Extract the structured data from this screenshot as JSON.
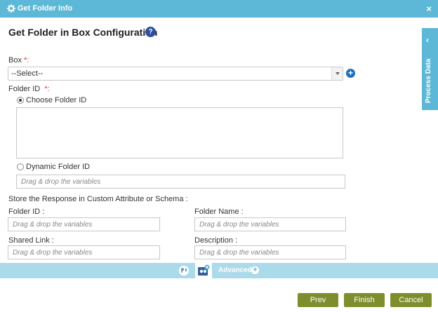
{
  "window": {
    "title": "Get Folder Info",
    "close_icon": "×"
  },
  "page": {
    "heading": "Get Folder in Box Configuration",
    "help_icon": "?"
  },
  "box": {
    "label": "Box",
    "required_mark": "*:",
    "selected": "--Select--"
  },
  "folder_id": {
    "label": "Folder ID",
    "required_mark": "*:",
    "choose_label": "Choose Folder ID",
    "dynamic_label": "Dynamic Folder ID",
    "dynamic_placeholder": "Drag & drop the variables"
  },
  "store": {
    "heading": "Store the Response in Custom Attribute or Schema :",
    "fields": [
      {
        "label": "Folder ID :",
        "placeholder": "Drag & drop the variables"
      },
      {
        "label": "Folder Name :",
        "placeholder": "Drag & drop the variables"
      },
      {
        "label": "Shared Link :",
        "placeholder": "Drag & drop the variables"
      },
      {
        "label": "Description :",
        "placeholder": "Drag & drop the variables"
      }
    ]
  },
  "toolbar": {
    "advanced_label": "Advanced"
  },
  "buttons": {
    "prev": "Prev",
    "finish": "Finish",
    "cancel": "Cancel"
  },
  "side_panel": {
    "label": "Process Data"
  },
  "colors": {
    "header": "#5cb8d6",
    "toolbar": "#abdaeb",
    "button": "#7f8e2c",
    "required": "#e03030",
    "help": "#2e4f9e"
  }
}
